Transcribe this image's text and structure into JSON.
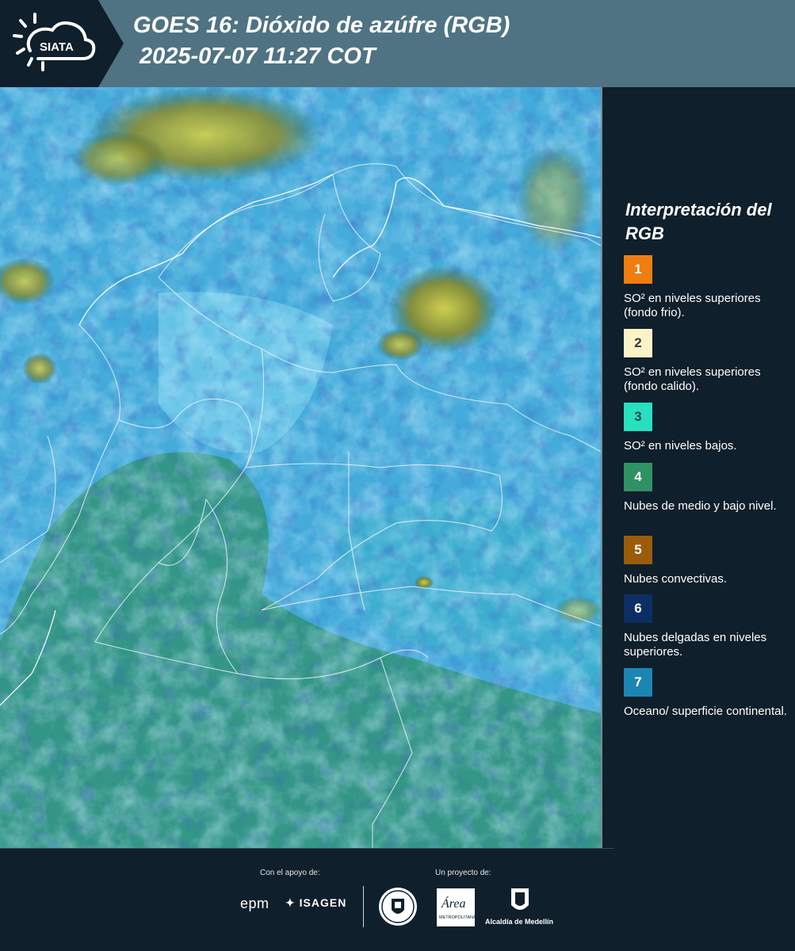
{
  "header": {
    "logo_text": "SIATA",
    "title": "GOES 16: Dióxido de azúfre (RGB)",
    "subtitle": "2025-07-07 11:27 COT"
  },
  "map": {
    "description_colors": {
      "ocean": "#2a9bd3",
      "vegetation": "#2f8f6a",
      "convective": "#c9c23a"
    }
  },
  "legend": {
    "title": "Interpretación del RGB",
    "items": [
      {
        "number": "1",
        "color": "#f07d10",
        "text_color": "#ffffff",
        "label": "SO² en niveles superiores (fondo frio)."
      },
      {
        "number": "2",
        "color": "#fbf3c6",
        "text_color": "#3a3a3a",
        "label": "SO² en niveles superiores (fondo calido)."
      },
      {
        "number": "3",
        "color": "#27e0c0",
        "text_color": "#1e4a44",
        "label": "SO² en niveles bajos."
      },
      {
        "number": "4",
        "color": "#2e9264",
        "text_color": "#ffffff",
        "label": "Nubes de medio y bajo nivel."
      },
      {
        "number": "5",
        "color": "#9a5c08",
        "text_color": "#ffffff",
        "label": "Nubes convectivas."
      },
      {
        "number": "6",
        "color": "#0c2f63",
        "text_color": "#ffffff",
        "label": "Nubes delgadas en niveles superiores."
      },
      {
        "number": "7",
        "color": "#1b86b4",
        "text_color": "#ffffff",
        "label": "Oceano/ superficie continental."
      }
    ]
  },
  "footer": {
    "support_label": "Con el apoyo de:",
    "project_label": "Un proyecto de:",
    "epm": "epm",
    "isagen": "ISAGEN",
    "area_text": "Área",
    "area_sub": "METROPOLITANA",
    "alcaldia": "Alcaldía de Medellín"
  }
}
